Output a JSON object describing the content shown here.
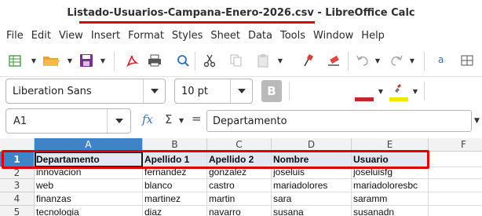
{
  "window": {
    "title": "Listado-Usuarios-Campana-Enero-2026.csv - LibreOffice Calc"
  },
  "menubar": {
    "items": [
      "File",
      "Edit",
      "View",
      "Insert",
      "Format",
      "Styles",
      "Sheet",
      "Data",
      "Tools",
      "Window",
      "Help"
    ]
  },
  "toolbar": {
    "icons": [
      "new-icon",
      "open-icon",
      "save-icon",
      "export-pdf-icon",
      "print-icon",
      "print-preview-icon",
      "cut-icon",
      "copy-icon",
      "paste-icon",
      "clone-formatting-icon",
      "clear-formatting-icon",
      "undo-icon",
      "redo-icon",
      "spelling-icon",
      "find-replace-icon"
    ]
  },
  "format": {
    "font_name": "Liberation Sans",
    "font_size": "10 pt",
    "bold_label": "B",
    "font_color": "#c0262a",
    "highlight_color": "#f5e600"
  },
  "formula": {
    "cell_ref": "A1",
    "fx": "fx",
    "sigma": "Σ",
    "equals": "=",
    "content": "Departamento"
  },
  "sheet": {
    "columns": [
      "A",
      "B",
      "C",
      "D",
      "E",
      "F"
    ],
    "rows": [
      {
        "num": "1",
        "cells": [
          "Departamento",
          "Apellido 1",
          "Apellido 2",
          "Nombre",
          "Usuario",
          ""
        ]
      },
      {
        "num": "2",
        "cells": [
          "innovacion",
          "fernandez",
          "gonzalez",
          "joseluis",
          "joseluisfg",
          ""
        ]
      },
      {
        "num": "3",
        "cells": [
          "web",
          "blanco",
          "castro",
          "mariadolores",
          "mariadoloresbc",
          ""
        ]
      },
      {
        "num": "4",
        "cells": [
          "finanzas",
          "martinez",
          "martin",
          "sara",
          "saramm",
          ""
        ]
      },
      {
        "num": "5",
        "cells": [
          "tecnologia",
          "diaz",
          "navarro",
          "susana",
          "susanadn",
          ""
        ]
      }
    ]
  },
  "colors": {
    "annotation_red": "#e00000",
    "selection_blue": "#3f84c9"
  }
}
